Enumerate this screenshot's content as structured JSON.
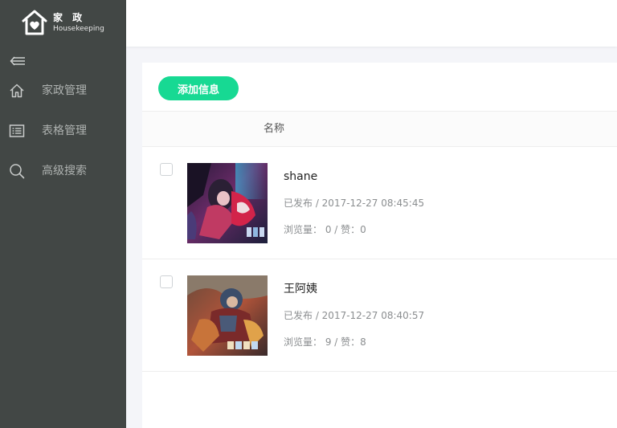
{
  "brand": {
    "title": "家 政",
    "subtitle": "Housekeeping"
  },
  "sidebar": {
    "items": [
      {
        "label": "家政管理",
        "icon": "home-icon"
      },
      {
        "label": "表格管理",
        "icon": "table-icon"
      },
      {
        "label": "高级搜索",
        "icon": "search-icon"
      }
    ]
  },
  "toolbar": {
    "add_label": "添加信息"
  },
  "table": {
    "columns": [
      "名称"
    ],
    "rows": [
      {
        "title": "shane",
        "meta": "已发布 / 2017-12-27 08:45:45",
        "stats": "浏览量： 0 / 赞：0"
      },
      {
        "title": "王阿姨",
        "meta": "已发布 / 2017-12-27 08:40:57",
        "stats": "浏览量： 9 / 赞：8"
      }
    ]
  },
  "colors": {
    "sidebar_bg": "#424745",
    "accent": "#17d993",
    "nav_text": "#aeb2b0"
  }
}
